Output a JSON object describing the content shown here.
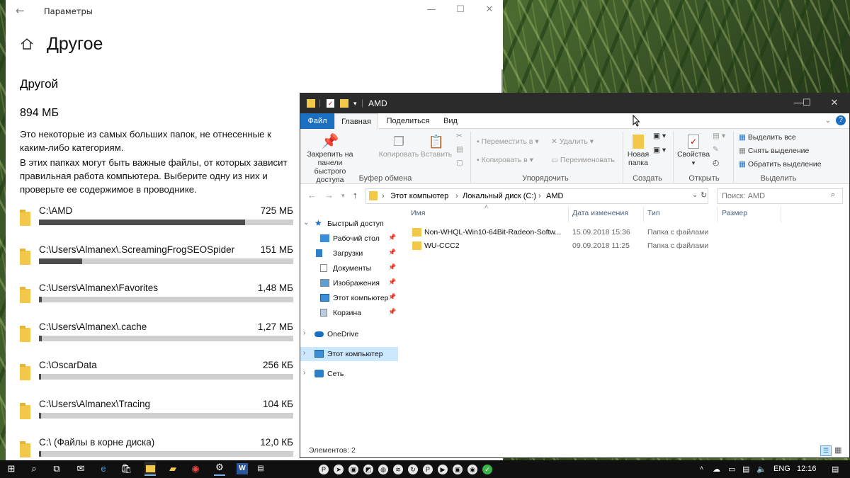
{
  "settings": {
    "app_title": "Параметры",
    "page_title": "Другое",
    "subheading": "Другой",
    "total_size": "894 МБ",
    "description1": "Это некоторые из самых больших папок, не отнесенные к каким-либо категориям.",
    "description2": "В этих папках могут быть важные файлы, от которых зависит правильная работа компьютера. Выберите одну из них и проверьте ее содержимое в проводнике.",
    "folders": [
      {
        "path": "C:\\AMD",
        "size": "725 МБ",
        "fill": 0.81
      },
      {
        "path": "C:\\Users\\Almanex\\.ScreamingFrogSEOSpider",
        "size": "151 МБ",
        "fill": 0.17
      },
      {
        "path": "C:\\Users\\Almanex\\Favorites",
        "size": "1,48 МБ",
        "fill": 0.01
      },
      {
        "path": "C:\\Users\\Almanex\\.cache",
        "size": "1,27 МБ",
        "fill": 0.01
      },
      {
        "path": "C:\\OscarData",
        "size": "256 КБ",
        "fill": 0.005
      },
      {
        "path": "C:\\Users\\Almanex\\Tracing",
        "size": "104 КБ",
        "fill": 0.005
      },
      {
        "path": "C:\\ (Файлы в корне диска)",
        "size": "12,0 КБ",
        "fill": 0.005
      }
    ]
  },
  "explorer": {
    "title": "AMD",
    "tabs": [
      "Файл",
      "Главная",
      "Поделиться",
      "Вид"
    ],
    "ribbon": {
      "pin_label": "Закрепить на панели быстрого доступа",
      "copy_label": "Копировать",
      "paste_label": "Вставить",
      "move_to": "Переместить в",
      "copy_to": "Копировать в",
      "delete": "Удалить",
      "rename": "Переименовать",
      "new_folder": "Новая папка",
      "properties": "Свойства",
      "select_all": "Выделить все",
      "select_none": "Снять выделение",
      "invert_selection": "Обратить выделение",
      "groups": [
        "Буфер обмена",
        "Упорядочить",
        "Создать",
        "Открыть",
        "Выделить"
      ]
    },
    "breadcrumb": [
      "Этот компьютер",
      "Локальный диск (C:)",
      "AMD"
    ],
    "search_placeholder": "Поиск: AMD",
    "nav": {
      "quick_access": "Быстрый доступ",
      "quick_items": [
        "Рабочий стол",
        "Загрузки",
        "Документы",
        "Изображения",
        "Этот компьютер",
        "Корзина"
      ],
      "onedrive": "OneDrive",
      "this_pc": "Этот компьютер",
      "network": "Сеть"
    },
    "columns": [
      "Имя",
      "Дата изменения",
      "Тип",
      "Размер"
    ],
    "files": [
      {
        "name": "Non-WHQL-Win10-64Bit-Radeon-Softw...",
        "date": "15.09.2018 15:36",
        "type": "Папка с файлами"
      },
      {
        "name": "WU-CCC2",
        "date": "09.09.2018 11:25",
        "type": "Папка с файлами"
      }
    ],
    "status": "Элементов: 2"
  },
  "taskbar": {
    "language": "ENG",
    "clock": "12:16"
  },
  "colors": {
    "accent": "#1a6fc0",
    "folder": "#f2c84a",
    "bar_fill": "#4c4c4c",
    "bar_track": "#cfcfcf"
  }
}
